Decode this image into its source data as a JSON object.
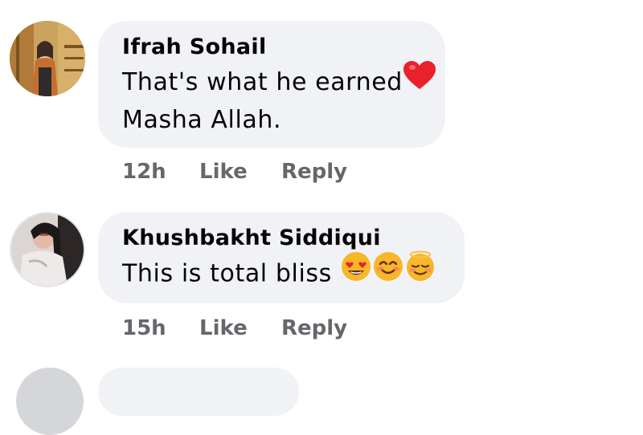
{
  "comments": [
    {
      "author": "Ifrah Sohail",
      "text_line1": "That's what he earned",
      "text_line2": "Masha Allah.",
      "emoji_line1": "red-heart",
      "time": "12h",
      "like_label": "Like",
      "reply_label": "Reply"
    },
    {
      "author": "Khushbakht Siddiqui",
      "text_line1": "This is total bliss",
      "emojis": [
        "heart-eyes",
        "smiling-face",
        "relieved-face"
      ],
      "time": "15h",
      "like_label": "Like",
      "reply_label": "Reply"
    }
  ],
  "colors": {
    "bubble": "#f0f2f5",
    "meta_text": "#65676b",
    "body_text": "#050505",
    "heart": "#e8212c",
    "emoji_yellow": "#f8b628"
  }
}
